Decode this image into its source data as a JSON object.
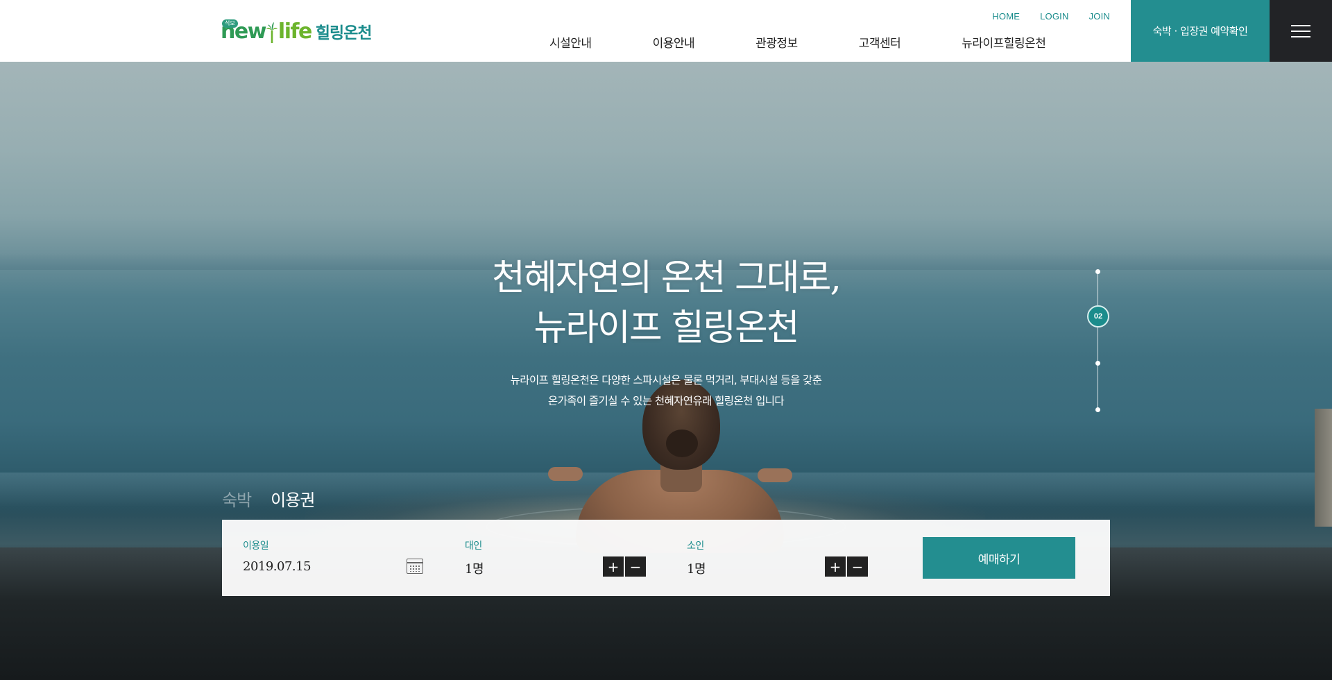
{
  "logo": {
    "badge": "석모",
    "text_new": "new",
    "text_life": "life",
    "text_ko": "힐링온천"
  },
  "util_links": [
    "HOME",
    "LOGIN",
    "JOIN"
  ],
  "nav": [
    "시설안내",
    "이용안내",
    "관광정보",
    "고객센터",
    "뉴라이프힐링온천"
  ],
  "reserve_check": "숙박 · 입장권 예약확인",
  "hero": {
    "headline_line1": "천혜자연의 온천 그대로,",
    "headline_line2": "뉴라이프 힐링온천",
    "desc_line1": "뉴라이프 힐링온천은 다양한 스파시설은 물론 먹거리, 부대시설 등을 갖춘",
    "desc_line2": "온가족이 즐기실 수 있는 천혜자연유래 힐링온천 입니다"
  },
  "pagination": {
    "active_label": "02",
    "total": 4,
    "active_index": 2
  },
  "booking": {
    "tabs": [
      {
        "label": "숙박",
        "active": false
      },
      {
        "label": "이용권",
        "active": true
      }
    ],
    "date": {
      "label": "이용일",
      "value": "2019.07.15"
    },
    "adult": {
      "label": "대인",
      "value": "1명"
    },
    "child": {
      "label": "소인",
      "value": "1명"
    },
    "plus": "+",
    "minus": "−",
    "submit": "예매하기"
  },
  "icons": {
    "calendar": "calendar-icon",
    "menu": "hamburger-menu-icon"
  },
  "colors": {
    "accent": "#238e90",
    "dark": "#222326",
    "logo_green": "#2f9a55",
    "logo_lime": "#6cb42d"
  }
}
